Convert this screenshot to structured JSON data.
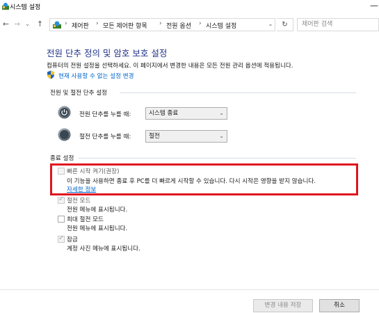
{
  "window": {
    "title": "시스템 설정",
    "minimize_glyph": "—"
  },
  "nav": {
    "back_glyph": "←",
    "forward_glyph": "→",
    "dropdown_glyph": "⌄",
    "up_glyph": "↑",
    "breadcrumbs": [
      "제어판",
      "모든 제어판 항목",
      "전원 옵션",
      "시스템 설정"
    ],
    "separator": "›",
    "addr_dropdown_glyph": "⌄",
    "refresh_glyph": "↻",
    "search_placeholder": "제어판 검색"
  },
  "page": {
    "title": "전원 단추 정의 및 암호 보호 설정",
    "description": "컴퓨터의 전원 설정을 선택하세요. 이 페이지에서 변경한 내용은 모든 전원 관리 옵션에 적용됩니다.",
    "change_link": "현재 사용할 수 없는 설정 변경"
  },
  "power_section": {
    "heading": "전원 및 절전 단추 설정",
    "rows": [
      {
        "label": "전원 단추를 누를 때:",
        "value": "시스템 종료",
        "icon": "power-button-icon"
      },
      {
        "label": "절전 단추를 누를 때:",
        "value": "절전",
        "icon": "sleep-button-icon"
      }
    ]
  },
  "shutdown_section": {
    "heading": "종료 설정",
    "fast_startup": {
      "title": "빠른 시작 켜기(권장)",
      "desc": "이 기능을 사용하면 종료 후 PC를 더 빠르게 시작할 수 있습니다. 다시 시작은 영향을 받지 않습니다.",
      "link": "자세한 정보",
      "checked": false
    },
    "sleep": {
      "title": "절전 모드",
      "desc": "전원 메뉴에 표시됩니다.",
      "checked": true
    },
    "hibernate": {
      "title": "최대 절전 모드",
      "desc": "전원 메뉴에 표시됩니다.",
      "checked": false
    },
    "lock": {
      "title": "잠금",
      "desc": "계정 사진 메뉴에 표시됩니다.",
      "checked": true
    }
  },
  "footer": {
    "save_label": "변경 내용 저장",
    "cancel_label": "취소"
  },
  "colors": {
    "highlight_box": "#e0141e",
    "link": "#0066cc",
    "title": "#1e3287"
  }
}
